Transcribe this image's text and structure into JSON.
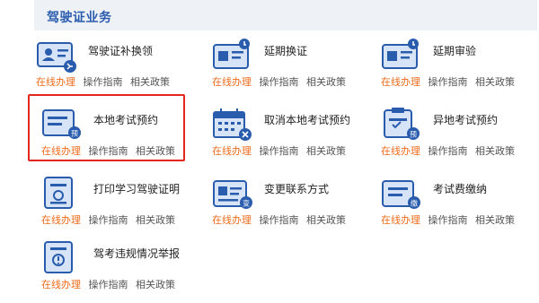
{
  "section": {
    "title": "驾驶证业务"
  },
  "links": {
    "online": "在线办理",
    "guide": "操作指南",
    "policy": "相关政策"
  },
  "colors": {
    "primary": "#2a5cae",
    "light": "#d7e4f7",
    "orange": "#ee6b1b",
    "highlight": "#e3271f"
  },
  "items": [
    {
      "title": "驾驶证补换领",
      "icon": "id-card-person-icon"
    },
    {
      "title": "延期换证",
      "icon": "id-card-extend-icon"
    },
    {
      "title": "延期审验",
      "icon": "id-card-review-icon"
    },
    {
      "title": "本地考试预约",
      "icon": "form-booking-icon"
    },
    {
      "title": "取消本地考试预约",
      "icon": "calendar-cancel-icon"
    },
    {
      "title": "异地考试预约",
      "icon": "clipboard-booking-icon"
    },
    {
      "title": "打印学习驾驶证明",
      "icon": "document-print-icon"
    },
    {
      "title": "变更联系方式",
      "icon": "contact-change-icon"
    },
    {
      "title": "考试费缴纳",
      "icon": "payment-icon"
    },
    {
      "title": "驾考违规情况举报",
      "icon": "report-icon"
    }
  ]
}
